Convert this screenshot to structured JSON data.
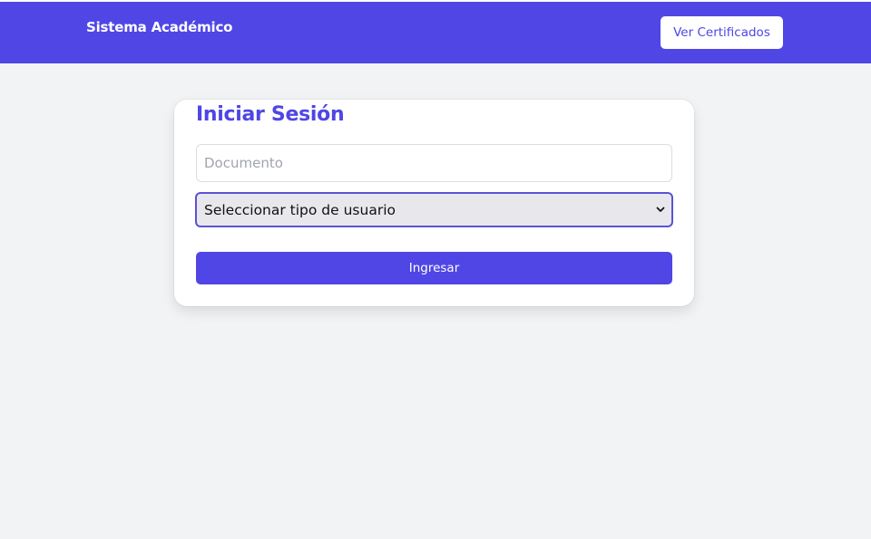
{
  "navbar": {
    "brand": "Sistema Académico",
    "certificates_button": "Ver Certificados",
    "background_color": "#4f46e5"
  },
  "login": {
    "title": "Iniciar Sesión",
    "document_field": {
      "placeholder": "Documento",
      "value": ""
    },
    "user_type_select": {
      "selected": "Seleccionar tipo de usuario",
      "icon": "chevron-down-icon"
    },
    "submit_label": "Ingresar",
    "accent_color": "#4f46e5"
  }
}
